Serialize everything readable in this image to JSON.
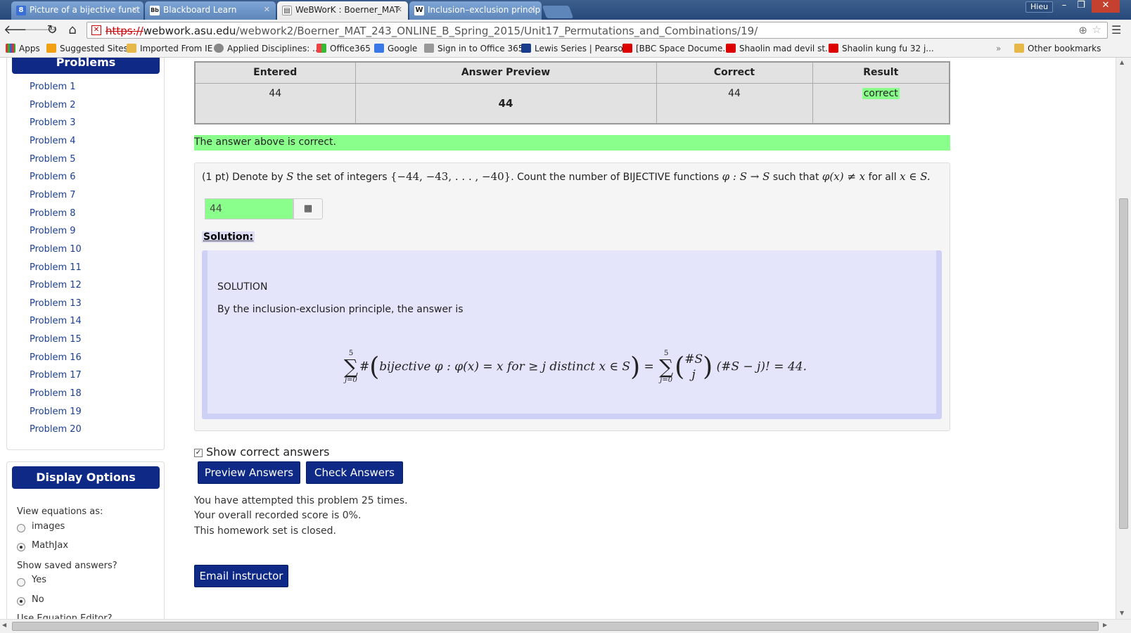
{
  "browser": {
    "tabs": [
      {
        "title": "Picture of a bijective funct",
        "icon": "8"
      },
      {
        "title": "Blackboard Learn",
        "icon": "Bb"
      },
      {
        "title": "WeBWorK : Boerner_MAT",
        "icon": "W"
      },
      {
        "title": "Inclusion–exclusion princip",
        "icon": "W"
      }
    ],
    "user": "Hieu",
    "url_protocol": "https://",
    "url_host": "webwork.asu.edu",
    "url_path": "/webwork2/Boerner_MAT_243_ONLINE_B_Spring_2015/Unit17_Permutations_and_Combinations/19/",
    "bookmarks": [
      "Apps",
      "Suggested Sites",
      "Imported From IE",
      "Applied Disciplines: ...",
      "Office365",
      "Google",
      "Sign in to Office 365",
      "Lewis Series | Pearson",
      "[BBC Space Docume...",
      "Shaolin mad devil st...",
      "Shaolin kung fu 32 j..."
    ],
    "other_bookmarks": "Other bookmarks",
    "overflow": "»"
  },
  "sidebar": {
    "problems_title": "Problems",
    "problems": [
      "Problem 1",
      "Problem 2",
      "Problem 3",
      "Problem 4",
      "Problem 5",
      "Problem 6",
      "Problem 7",
      "Problem 8",
      "Problem 9",
      "Problem 10",
      "Problem 11",
      "Problem 12",
      "Problem 13",
      "Problem 14",
      "Problem 15",
      "Problem 16",
      "Problem 17",
      "Problem 18",
      "Problem 19",
      "Problem 20"
    ],
    "display_title": "Display Options",
    "view_equations_label": "View equations as:",
    "opt_images": "images",
    "opt_mathjax": "MathJax",
    "saved_answers_label": "Show saved answers?",
    "opt_yes": "Yes",
    "opt_no": "No",
    "equation_editor_label": "Use Equation Editor?"
  },
  "results": {
    "headers": [
      "Entered",
      "Answer Preview",
      "Correct",
      "Result"
    ],
    "entered": "44",
    "preview": "44",
    "correct": "44",
    "result": "correct"
  },
  "banner": "The answer above is correct.",
  "problem": {
    "pts": "(1 pt) Denote by",
    "S": "S",
    "t1": "the set of integers",
    "set": "{−44, −43, . . . , −40}",
    "t2": ". Count the number of BIJECTIVE functions",
    "func": "φ : S → S",
    "t3": "such that",
    "cond": "φ(x) ≠ x",
    "t4": "for all",
    "dom": "x ∈ S.",
    "answer_value": "44",
    "solution_link": "Solution:",
    "solution_heading": "SOLUTION",
    "solution_text": "By the inclusion-exclusion principle, the answer is",
    "formula": {
      "upper": "5",
      "lower": "j=0",
      "hash": "#",
      "inner": "bijective φ : φ(x) = x for  ≥ j distinct x ∈ S",
      "eq": "=",
      "binom_top": "#S",
      "binom_bot": "j",
      "tail": "(#S − j)! = 44."
    }
  },
  "show_correct_label": "Show correct answers",
  "buttons": {
    "preview": "Preview Answers",
    "check": "Check Answers",
    "email": "Email instructor"
  },
  "status": {
    "attempts": "You have attempted this problem 25 times.",
    "score": "Your overall recorded score is 0%.",
    "closed": "This homework set is closed."
  },
  "colors": {
    "navy": "#0e2a86",
    "correct_green": "#8bff8b",
    "solution_bg": "#e4e4fb"
  }
}
